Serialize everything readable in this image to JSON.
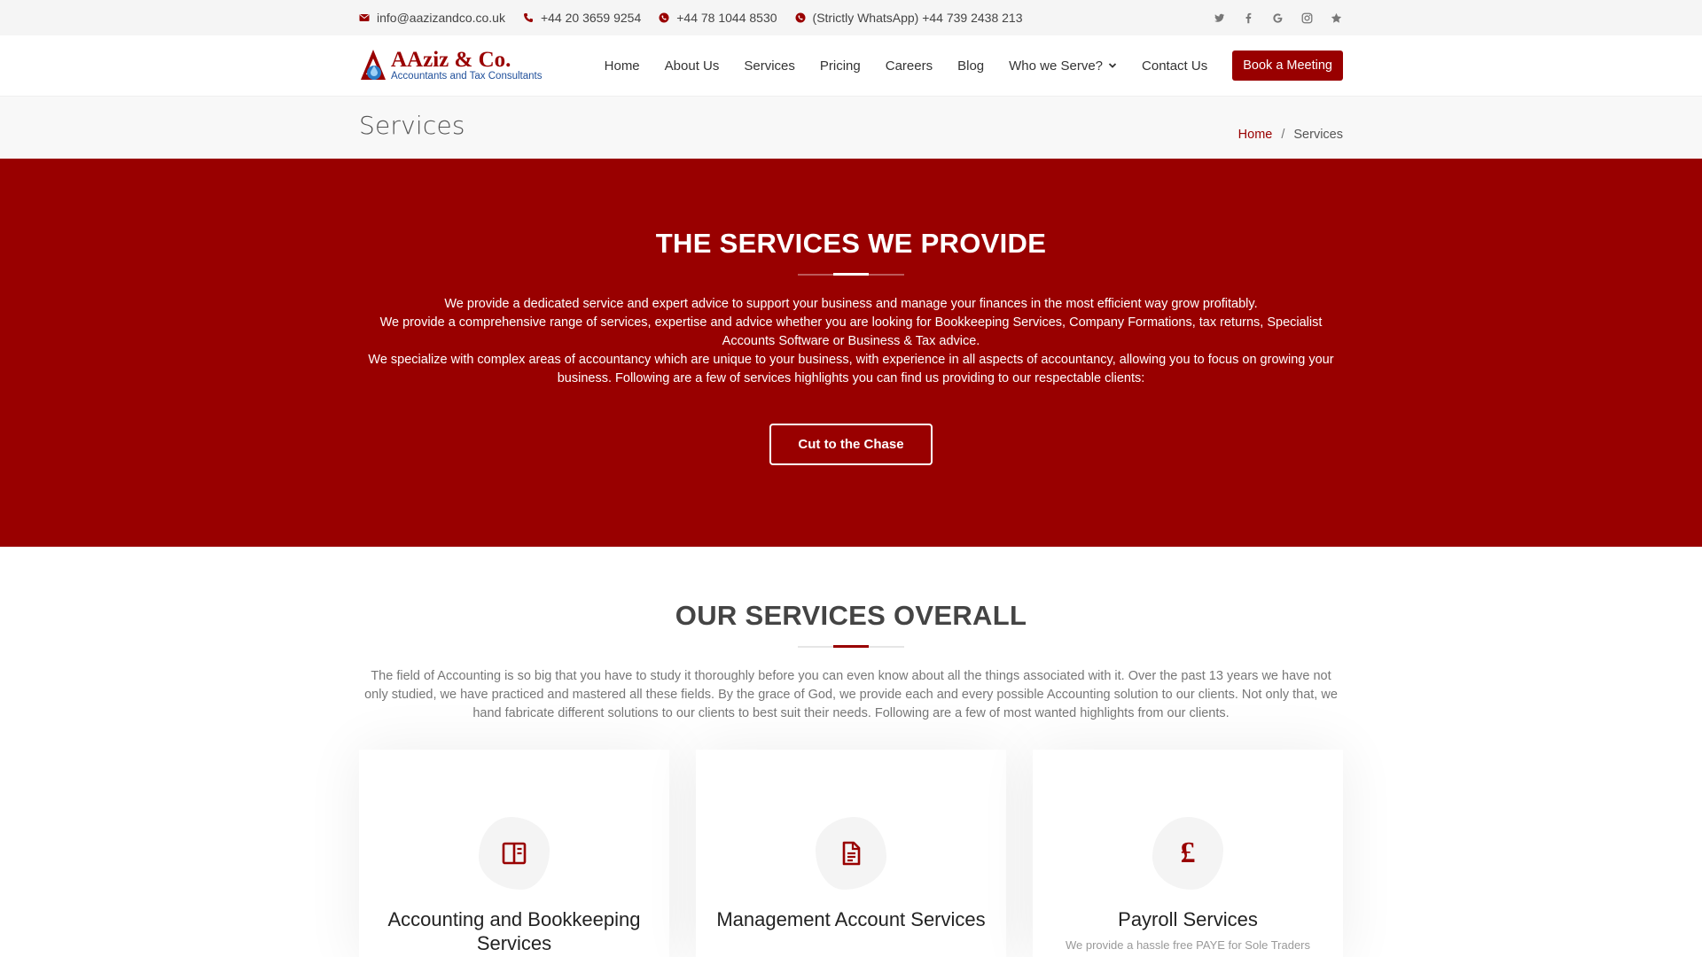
{
  "topbar": {
    "email": "info@aazizandco.co.uk",
    "phone": "+44 20 3659 9254",
    "mobile": "+44 78 1044 8530",
    "whatsapp": "(Strictly WhatsApp) +44 739 2438 213",
    "social": [
      "twitter-icon",
      "facebook-icon",
      "google-icon",
      "instagram-icon",
      "star-icon"
    ]
  },
  "header": {
    "logo_name": "AAziz & Co.",
    "logo_tagline": "Accountants and Tax Consultants",
    "nav": [
      "Home",
      "About Us",
      "Services",
      "Pricing",
      "Careers",
      "Blog",
      "Who we Serve?",
      "Contact Us"
    ],
    "cta": "Book a Meeting"
  },
  "titlebar": {
    "title": "Services",
    "breadcrumb_home": "Home",
    "breadcrumb_sep": "/",
    "breadcrumb_current": "Services"
  },
  "hero": {
    "heading": "THE SERVICES WE PROVIDE",
    "para1": "We provide a dedicated service and expert advice to support your business and manage your finances in the most efficient way grow profitably.",
    "para2": "We provide a comprehensive range of services, expertise and advice whether you are looking for Bookkeeping Services, Company Formations, tax returns, Specialist Accounts Software or Business & Tax advice.",
    "para3": "We specialize with complex areas of accountancy which are unique to your business, with experience in all aspects of accountancy, allowing you to focus on growing your business. Following are a few of services highlights you can find us providing to our respectable clients:",
    "button": "Cut to the Chase"
  },
  "overall": {
    "heading": "OUR SERVICES OVERALL",
    "intro": "The field of Accounting is so big that you have to study it thoroughly before you can even know about all the things associated with it. Over the past 13 years we have not only studied, we have practiced and mastered all these fields. By the grace of God, we provide each and every possible Accounting solution to our clients. Not only that, we hand fabricate different solutions to our clients to best suit their needs. Following are a few of most wanted highlights from our clients."
  },
  "cards": [
    {
      "title": "Accounting and Bookkeeping Services",
      "icon": "book-icon",
      "text": ""
    },
    {
      "title": "Management Account Services",
      "icon": "document-icon",
      "text": ""
    },
    {
      "title": "Payroll Services",
      "icon": "pound-icon",
      "symbol": "£",
      "text": "We provide a hassle free PAYE for Sole Traders"
    }
  ],
  "colors": {
    "brand": "#990000",
    "topbar_bg": "#f5f5f5",
    "titlebar_bg": "#f8f8f8"
  }
}
